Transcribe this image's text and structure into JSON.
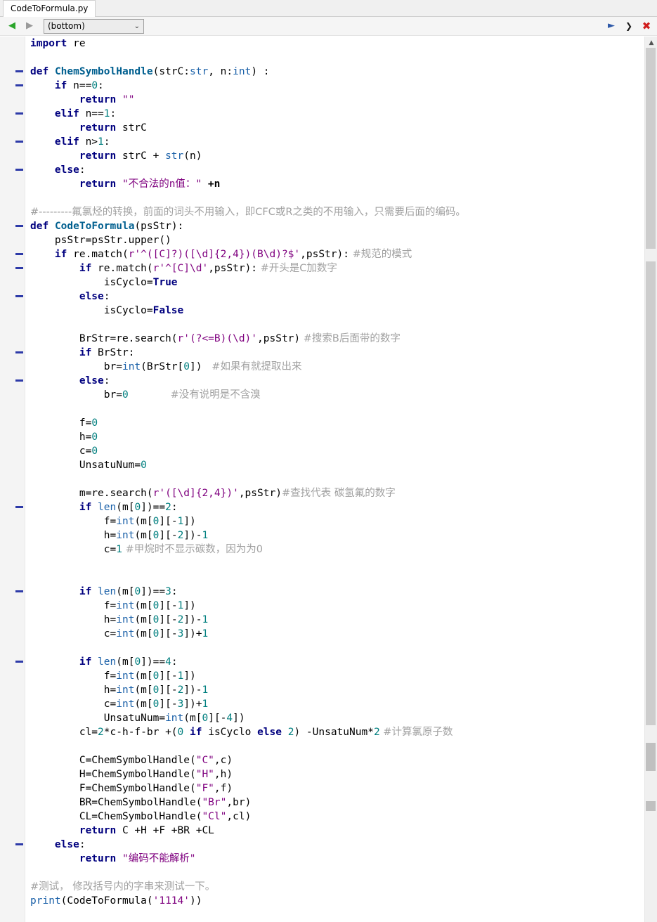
{
  "tab": {
    "title": "CodeToFormula.py"
  },
  "toolbar": {
    "back_icon": "back-arrow-icon",
    "forward_icon": "forward-arrow-icon",
    "dropdown_value": "(bottom)",
    "icons": [
      "pin-icon",
      "collapse-icon",
      "close-icon"
    ]
  },
  "code": {
    "l1": "import",
    "l1b": " re",
    "def1": "def",
    "def1_name": "ChemSymbolHandle",
    "def1_args_a": "(strC:",
    "def1_args_b": "str",
    "def1_args_c": ", n:",
    "def1_args_d": "int",
    "def1_args_e": ") :",
    "if": "if",
    "elif": "elif",
    "else": "else",
    "return": "return",
    "n_eq": " n==",
    "n_gt": " n>",
    "zero": "0",
    "one": "1",
    "colon": ":",
    "empty_str": "\"\"",
    "strC": " strC",
    "strC_plus": " strC + ",
    "str_fn": "str",
    "n_paren": "(n)",
    "bad_n": "\"不合法的n值：\"",
    "plus_n": " +n",
    "comment1": "#---------氟氯烃的转换，前面的词头不用输入，即CFC或R之类的不用输入，只需要后面的编码。",
    "def2_name": "CodeToFormula",
    "def2_args": "(psStr):",
    "upper": "psStr=psStr.upper()",
    "re_match": " re.match(",
    "regex1": "r'^([C]?)([\\d]{2,4})(B\\d)?$'",
    "ps_close": ",psStr):",
    "cm_norm": " #规范的模式",
    "regex2": "r'^[C]\\d'",
    "cm_c": " #开头是C加数字",
    "iscyclo_true_a": "isCyclo=",
    "true": "True",
    "false": "False",
    "brstr_a": "BrStr=re.search(",
    "regex3": "r'(?<=B)(\\d)'",
    "brstr_b": ",psStr)",
    "cm_b": " #搜索B后面带的数字",
    "if_brstr": " BrStr:",
    "br_a": "br=",
    "int_fn": "int",
    "br_b": "(BrStr[",
    "br_c": "])",
    "cm_extract": "   #如果有就提取出来",
    "br0": "br=",
    "cm_nobr": "             #没有说明是不含溴",
    "f0": "f=",
    "h0": "h=",
    "c0": "c=",
    "unsat0": "UnsatuNum=",
    "m_a": "m=re.search(",
    "regex4": "r'([\\d]{2,4})'",
    "m_b": ",psStr)",
    "cm_find": "#查找代表 碳氢氟的数字",
    "len_fn": "len",
    "m0": "(m[",
    "m0_close2": "])==",
    "two": "2",
    "three": "3",
    "four": "4",
    "f_eq": "f=",
    "h_eq": "h=",
    "c_eq": "c=",
    "unsat_eq": "UnsatuNum=",
    "idx_open": "(m[",
    "idx_mid": "][-",
    "idx_close": "])",
    "minus1": "-",
    "plus1": "+",
    "c1": "c=",
    "cm_methane": " #甲烷时不显示碳数，因为为0",
    "cl_a": "cl=",
    "cl_b": "*c-h-f-br +(",
    "cl_c": " isCyclo ",
    "cl_d": " ",
    "cl_e": ") -UnsatuNum*",
    "cm_cl": " #计算氯原子数",
    "C_a": "C=ChemSymbolHandle(",
    "C_s": "\"C\"",
    "C_b": ",c)",
    "H_a": "H=ChemSymbolHandle(",
    "H_s": "\"H\"",
    "H_b": ",h)",
    "F_a": "F=ChemSymbolHandle(",
    "F_s": "\"F\"",
    "F_b": ",f)",
    "BR_a": "BR=ChemSymbolHandle(",
    "BR_s": "\"Br\"",
    "BR_b": ",br)",
    "CL_a": "CL=ChemSymbolHandle(",
    "CL_s": "\"Cl\"",
    "CL_b": ",cl)",
    "ret_all": " C +H +F +BR +CL",
    "cannot": "\"编码不能解析\"",
    "cm_test": "#测试， 修改括号内的字串来测试一下。",
    "print_fn": "print",
    "print_a": "(CodeToFormula(",
    "print_s": "'1114'",
    "print_b": "))"
  }
}
